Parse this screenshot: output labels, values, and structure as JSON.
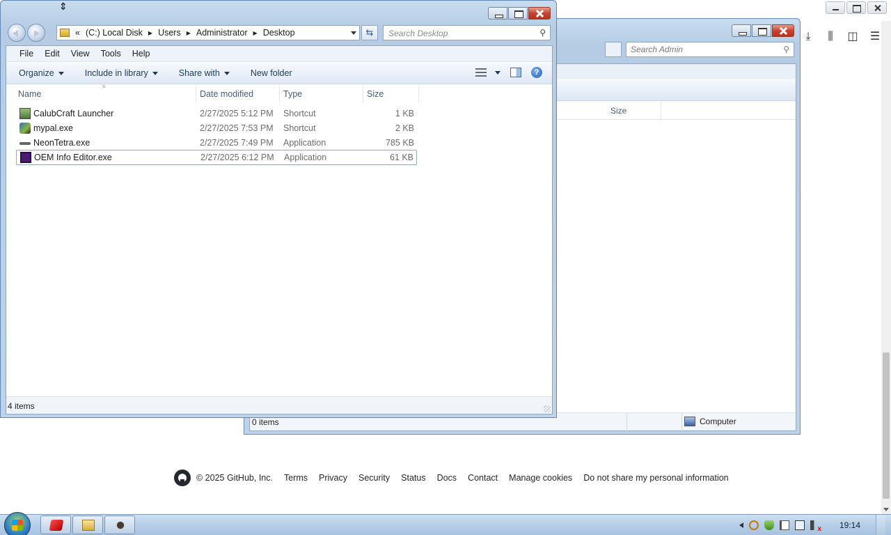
{
  "browser": {
    "footer": {
      "copyright": "© 2025 GitHub, Inc.",
      "links": [
        "Terms",
        "Privacy",
        "Security",
        "Status",
        "Docs",
        "Contact",
        "Manage cookies",
        "Do not share my personal information"
      ]
    }
  },
  "back_explorer": {
    "search_placeholder": "Search Admin",
    "column_size": "Size",
    "status_count": "0 items",
    "status_location": "Computer"
  },
  "explorer": {
    "address": {
      "prefix": "«",
      "crumbs": [
        "(C:) Local Disk",
        "Users",
        "Administrator",
        "Desktop"
      ]
    },
    "search_placeholder": "Search Desktop",
    "menu": [
      "File",
      "Edit",
      "View",
      "Tools",
      "Help"
    ],
    "commands": {
      "organize": "Organize",
      "include_in_library": "Include in library",
      "share_with": "Share with",
      "new_folder": "New folder"
    },
    "columns": {
      "name": "Name",
      "date_modified": "Date modified",
      "type": "Type",
      "size": "Size"
    },
    "files": [
      {
        "name": "CalubCraft Launcher",
        "date": "2/27/2025 5:12 PM",
        "type": "Shortcut",
        "size": "1 KB",
        "icon": "calubcraft-icon"
      },
      {
        "name": "mypal.exe",
        "date": "2/27/2025 7:53 PM",
        "type": "Shortcut",
        "size": "2 KB",
        "icon": "mypal-icon"
      },
      {
        "name": "NeonTetra.exe",
        "date": "2/27/2025 7:49 PM",
        "type": "Application",
        "size": "785 KB",
        "icon": "neontetra-icon"
      },
      {
        "name": "OEM Info Editor.exe",
        "date": "2/27/2025 6:12 PM",
        "type": "Application",
        "size": "61 KB",
        "icon": "oem-editor-icon"
      }
    ],
    "status_count": "4 items"
  },
  "taskbar": {
    "clock": "19:14"
  }
}
